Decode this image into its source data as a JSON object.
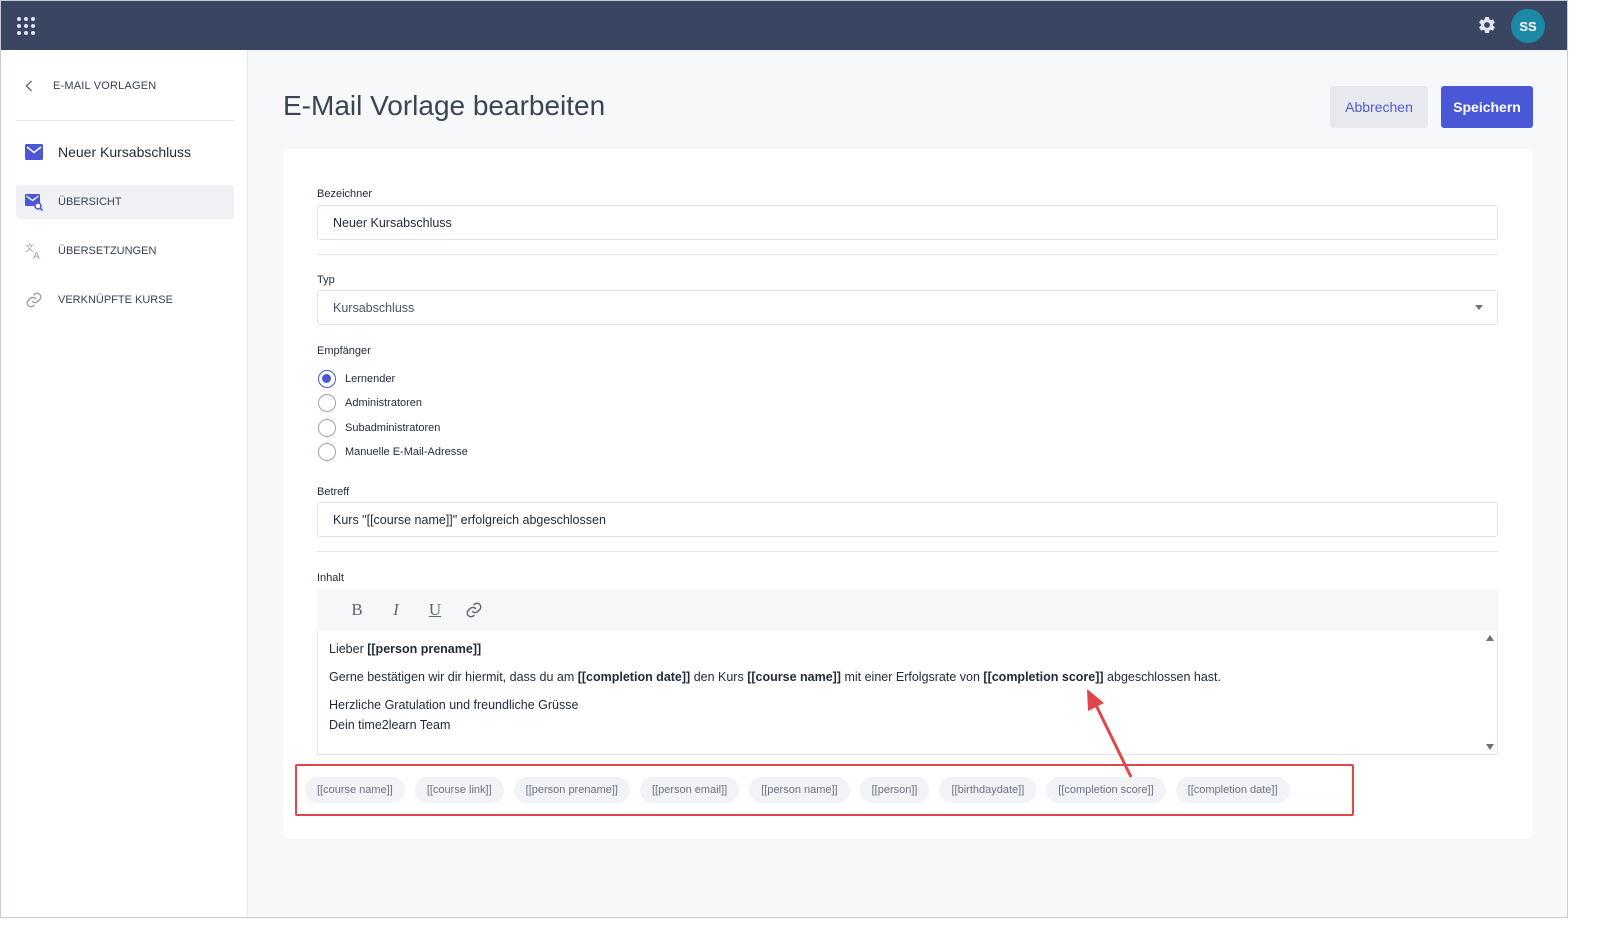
{
  "topbar": {
    "avatar_initials": "SS",
    "apps_icon": "grid-dots-icon",
    "settings_icon": "gear-icon"
  },
  "sidebar": {
    "back_label": "E-MAIL VORLAGEN",
    "title": "Neuer Kursabschluss",
    "items": [
      {
        "label": "ÜBERSICHT",
        "icon": "mail-search-icon",
        "active": true
      },
      {
        "label": "ÜBERSETZUNGEN",
        "icon": "translate-icon",
        "active": false
      },
      {
        "label": "VERKNÜPFTE KURSE",
        "icon": "link-icon",
        "active": false
      }
    ]
  },
  "header": {
    "title": "E-Mail Vorlage bearbeiten",
    "cancel_label": "Abbrechen",
    "save_label": "Speichern"
  },
  "form": {
    "identifier_label": "Bezeichner",
    "identifier_value": "Neuer Kursabschluss",
    "type_label": "Typ",
    "type_value": "Kursabschluss",
    "recipient_label": "Empfänger",
    "recipients": [
      {
        "label": "Lernender",
        "checked": true
      },
      {
        "label": "Administratoren",
        "checked": false
      },
      {
        "label": "Subadministratoren",
        "checked": false
      },
      {
        "label": "Manuelle E-Mail-Adresse",
        "checked": false
      }
    ],
    "subject_label": "Betreff",
    "subject_value": "Kurs \"[[course name]]\" erfolgreich abgeschlossen",
    "content_label": "Inhalt"
  },
  "editor": {
    "toolbar": [
      "B",
      "I",
      "U"
    ],
    "greeting": "Lieber ",
    "greeting_var": "[[person prename]]",
    "line2_a": "Gerne bestätigen wir dir hiermit, dass du am ",
    "line2_var1": "[[completion date]]",
    "line2_b": " den Kurs ",
    "line2_var2": "[[course name]]",
    "line2_c": " mit einer Erfolgsrate von ",
    "line2_var3": "[[completion score]]",
    "line2_d": " abgeschlossen hast.",
    "line3": "Herzliche Gratulation und freundliche Grüsse",
    "line4": "Dein time2learn Team"
  },
  "placeholders": [
    "[[course name]]",
    "[[course link]]",
    "[[person prename]]",
    "[[person email]]",
    "[[person name]]",
    "[[person]]",
    "[[birthdaydate]]",
    "[[completion score]]",
    "[[completion date]]"
  ],
  "colors": {
    "topbar": "#3a4661",
    "accent": "#4a57d6",
    "avatar": "#1d8aa5",
    "highlight": "#e0474c"
  }
}
